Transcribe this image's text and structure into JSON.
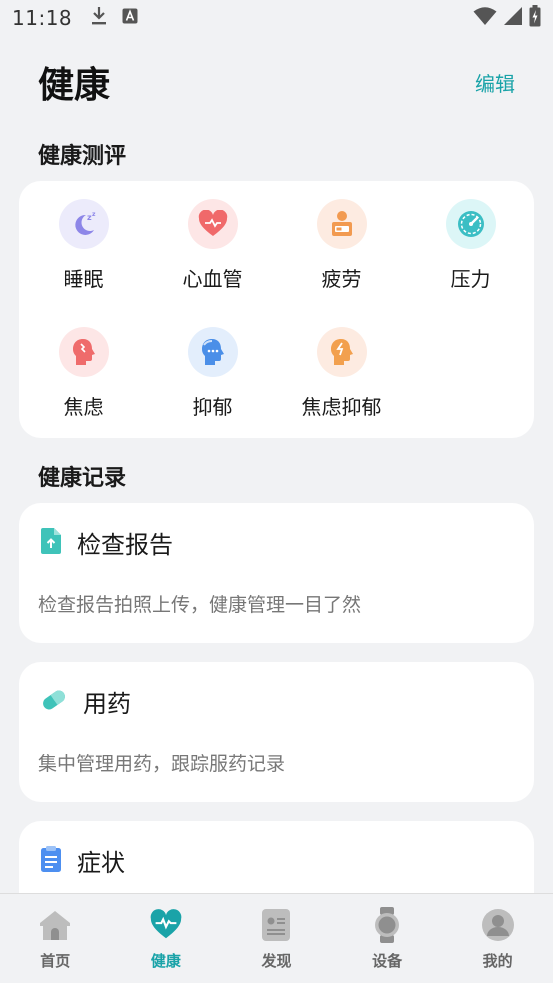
{
  "status_bar": {
    "time": "11:18"
  },
  "header": {
    "title": "健康",
    "edit_label": "编辑"
  },
  "evaluation": {
    "section_title": "健康测评",
    "items": [
      {
        "label": "睡眠",
        "icon": "sleep-icon",
        "bg": "#ecebfb"
      },
      {
        "label": "心血管",
        "icon": "heart-icon",
        "bg": "#fde6e6"
      },
      {
        "label": "疲劳",
        "icon": "fatigue-icon",
        "bg": "#fdebe1"
      },
      {
        "label": "压力",
        "icon": "gauge-icon",
        "bg": "#dcf6f7"
      },
      {
        "label": "焦虑",
        "icon": "anxiety-head-icon",
        "bg": "#fde6e6"
      },
      {
        "label": "抑郁",
        "icon": "depression-head-icon",
        "bg": "#e3eefc"
      },
      {
        "label": "焦虑抑郁",
        "icon": "anxiety-depression-head-icon",
        "bg": "#fdebe1"
      }
    ]
  },
  "records": {
    "section_title": "健康记录",
    "items": [
      {
        "title": "检查报告",
        "desc": "检查报告拍照上传，健康管理一目了然",
        "icon": "upload-document-icon"
      },
      {
        "title": "用药",
        "desc": "集中管理用药，跟踪服药记录",
        "icon": "pill-icon"
      },
      {
        "title": "症状",
        "desc": "",
        "icon": "clipboard-icon"
      }
    ]
  },
  "tabbar": {
    "active": "健康",
    "tabs": [
      {
        "label": "首页",
        "icon": "home-icon"
      },
      {
        "label": "健康",
        "icon": "heart-pulse-icon"
      },
      {
        "label": "发现",
        "icon": "discover-card-icon"
      },
      {
        "label": "设备",
        "icon": "watch-icon"
      },
      {
        "label": "我的",
        "icon": "profile-icon"
      }
    ]
  },
  "colors": {
    "accent": "#1aa3a8",
    "background": "#f1f2f4",
    "card": "#ffffff",
    "muted_text": "#777777"
  }
}
